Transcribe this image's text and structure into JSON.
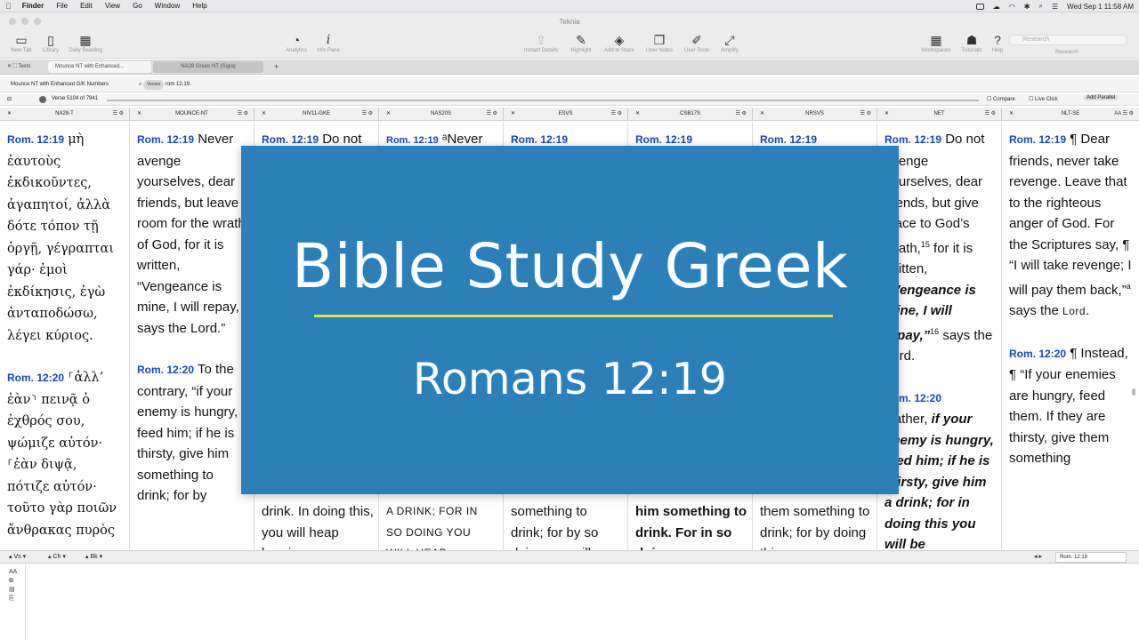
{
  "menubar": {
    "apple": "",
    "app": "Finder",
    "items": [
      "File",
      "Edit",
      "View",
      "Go",
      "Window",
      "Help"
    ],
    "clock": "Wed Sep 1  11:58 AM"
  },
  "window": {
    "title": "Teknia"
  },
  "toolbar": {
    "left": [
      {
        "label": "New Tab",
        "icon": "tab-icon"
      },
      {
        "label": "Library",
        "icon": "book-icon"
      },
      {
        "label": "Daily Reading",
        "icon": "calendar-icon"
      }
    ],
    "mid": [
      {
        "label": "Analytics",
        "icon": "pie-icon"
      },
      {
        "label": "Info Pane",
        "icon": "info-icon"
      }
    ],
    "right": [
      {
        "label": "Instant Details",
        "icon": "export-icon"
      },
      {
        "label": "Highlight",
        "icon": "pen-icon"
      },
      {
        "label": "Add to Stack",
        "icon": "layers-icon"
      },
      {
        "label": "User Notes",
        "icon": "notes-icon"
      },
      {
        "label": "User Tools",
        "icon": "edit-icon"
      },
      {
        "label": "Amplify",
        "icon": "expand-icon"
      }
    ],
    "far": [
      {
        "label": "Workspaces",
        "icon": "grid-icon"
      },
      {
        "label": "Tutorials",
        "icon": "cap-icon"
      },
      {
        "label": "Help",
        "icon": "help-icon"
      }
    ],
    "search_placeholder": "Research",
    "search_label": "Research"
  },
  "tabs": {
    "texts": "Texts",
    "tab1": "Mounce NT with Enhanced...",
    "tab2": "NA28 Greek NT (Sigla)"
  },
  "controls": {
    "resource": "Mounce NT with Enhanced G/K Numbers",
    "scope": "Verses",
    "query": "rom 12.19.",
    "verse_pos": "Verse 5104 of 7941",
    "compare": "Compare",
    "live_click": "Live Click",
    "add_parallel": "Add Parallel"
  },
  "columns": [
    {
      "name": "NA28-T"
    },
    {
      "name": "MOUNCE-NT"
    },
    {
      "name": "NIV11-GKE"
    },
    {
      "name": "NAS20S"
    },
    {
      "name": "ESVS"
    },
    {
      "name": "CSB17S"
    },
    {
      "name": "NRSVS"
    },
    {
      "name": "NET"
    },
    {
      "name": "NLT-SE"
    }
  ],
  "text": {
    "na28_ref": "Rom. 12:19",
    "na28_v19": "μὴ ἑαυτοὺς ἐκδικοῦντες, ἀγαπητοί, ἀλλὰ δότε τόπον τῇ ὀργῇ, γέγραπται γάρ· ἐμοὶ ἐκδίκησις, ἐγὼ ἀνταποδώσω, λέγει κύριος.",
    "na28_ref2": "Rom. 12:20",
    "na28_v20": "⸀ἀλλ’ ἐὰν⸃ πεινᾷ ὁ ἐχθρός σου, ψώμιζε αὐτόν· ⸀ἐὰν διψᾷ, πότιζε αὐτόν· τοῦτο γὰρ ποιῶν ἄνθρακας πυρὸς",
    "mounce_ref": "Rom. 12:19",
    "mounce_v19": "Never avenge yourselves, dear friends, but leave room for the wrath of God, for it is written, “Vengeance is mine, I will repay, says the Lord.”",
    "mounce_ref2": "Rom. 12:20",
    "mounce_v20": "To the contrary, “if your enemy is hungry, feed him; if he is thirsty, give him something to drink; for by",
    "niv_ref": "Rom. 12:19",
    "niv_top": "Do not",
    "niv_bottom": "drink.  In doing this, you will heap burning",
    "nas_ref": "Rom. 12:19",
    "nas_top": "ᵃNever",
    "nas_bottom1": "A DRINK; FOR IN",
    "nas_bottom2": "SO DOING YOU",
    "nas_bottom3": "WILL HEAP",
    "esv_ref": "Rom. 12:19",
    "esv_bottom": "something to drink; for by so doing you will",
    "csb_ref": "Rom. 12:19",
    "csb_bottom": "him something to drink.   For in so doing",
    "nrsv_ref": "Rom. 12:19",
    "nrsv_bottom": "them something to drink; for by doing this you",
    "net_ref": "Rom. 12:19",
    "net_v19a": "Do not avenge yourselves, dear friends, but give place to God’s wrath,",
    "net_fn15": "15",
    "net_v19b": " for it is written,",
    "net_v19c": "“Vengeance is mine, I will repay,”",
    "net_fn16": "16",
    "net_v19d": " says the Lord.",
    "net_ref2": "Rom. 12:20",
    "net_v20a": "Rather, ",
    "net_v20b": "if your enemy is hungry, feed him; if he is thirsty, give him a drink; for in doing this you will be",
    "nlt_ref": "Rom. 12:19",
    "nlt_v19a": "¶ Dear friends, never take revenge. Leave that to the righteous anger of God. For the Scriptures say, ¶ “I will take revenge;   I will pay them back,”",
    "nlt_fn": "a",
    "nlt_v19b": "   says the ",
    "nlt_lord": "Lord",
    "nlt_v19c": ".",
    "nlt_ref2": "Rom. 12:20",
    "nlt_v20": "¶ Instead,   ¶ “If your enemies are hungry, feed them.   If they are thirsty, give them something"
  },
  "bottom": {
    "vs": "Vs",
    "ch": "Ch",
    "bk": "Bk",
    "ref": "Rom. 12:19"
  },
  "overlay": {
    "title": "Bible Study Greek",
    "subtitle": "Romans 12:19",
    "bg": "#2b80b9",
    "accent": "#d7e64f"
  }
}
